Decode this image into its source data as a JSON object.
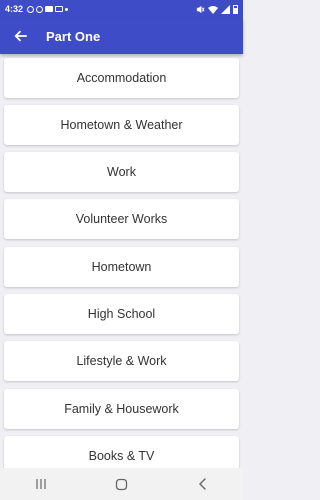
{
  "status_bar": {
    "time": "4:32",
    "left_icons": [
      "notification-icon",
      "notification-icon",
      "message-icon",
      "email-icon",
      "dot-icon"
    ],
    "right_icons": [
      "mute-icon",
      "wifi-icon",
      "signal-icon",
      "battery-icon"
    ]
  },
  "app_bar": {
    "title": "Part One",
    "back_icon": "back-arrow-icon",
    "color": "#3f4cc7"
  },
  "topics": [
    {
      "label": "Accommodation"
    },
    {
      "label": "Hometown & Weather"
    },
    {
      "label": "Work"
    },
    {
      "label": "Volunteer Works"
    },
    {
      "label": "Hometown"
    },
    {
      "label": "High School"
    },
    {
      "label": "Lifestyle & Work"
    },
    {
      "label": "Family & Housework"
    },
    {
      "label": "Books & TV"
    }
  ],
  "nav_bar": {
    "buttons": [
      "recent-apps-icon",
      "home-icon",
      "back-icon"
    ]
  }
}
